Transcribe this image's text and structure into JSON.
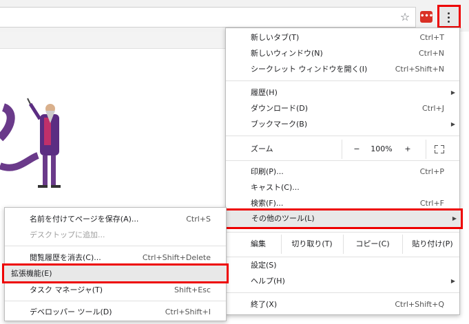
{
  "main_menu": {
    "items": [
      {
        "label": "新しいタブ(T)",
        "shortcut": "Ctrl+T"
      },
      {
        "label": "新しいウィンドウ(N)",
        "shortcut": "Ctrl+N"
      },
      {
        "label": "シークレット ウィンドウを開く(I)",
        "shortcut": "Ctrl+Shift+N"
      },
      {
        "label": "履歴(H)"
      },
      {
        "label": "ダウンロード(D)",
        "shortcut": "Ctrl+J"
      },
      {
        "label": "ブックマーク(B)"
      },
      {
        "label": "印刷(P)...",
        "shortcut": "Ctrl+P"
      },
      {
        "label": "キャスト(C)..."
      },
      {
        "label": "検索(F)...",
        "shortcut": "Ctrl+F"
      },
      {
        "label": "その他のツール(L)"
      },
      {
        "label": "設定(S)"
      },
      {
        "label": "ヘルプ(H)"
      },
      {
        "label": "終了(X)",
        "shortcut": "Ctrl+Shift+Q"
      }
    ],
    "zoom": {
      "label": "ズーム",
      "minus": "−",
      "value": "100%",
      "plus": "+"
    },
    "edit": {
      "label": "編集",
      "cut": "切り取り(T)",
      "copy": "コピー(C)",
      "paste": "貼り付け(P)"
    }
  },
  "sub_menu": {
    "items": [
      {
        "label": "名前を付けてページを保存(A)...",
        "shortcut": "Ctrl+S"
      },
      {
        "label": "デスクトップに追加..."
      },
      {
        "label": "閲覧履歴を消去(C)...",
        "shortcut": "Ctrl+Shift+Delete"
      },
      {
        "label": "拡張機能(E)"
      },
      {
        "label": "タスク マネージャ(T)",
        "shortcut": "Shift+Esc"
      },
      {
        "label": "デベロッパー ツール(D)",
        "shortcut": "Ctrl+Shift+I"
      }
    ]
  },
  "toolbar": {
    "ext_label": "•••"
  },
  "colors": {
    "highlight_border": "#e00000",
    "accent": "#d93025"
  }
}
